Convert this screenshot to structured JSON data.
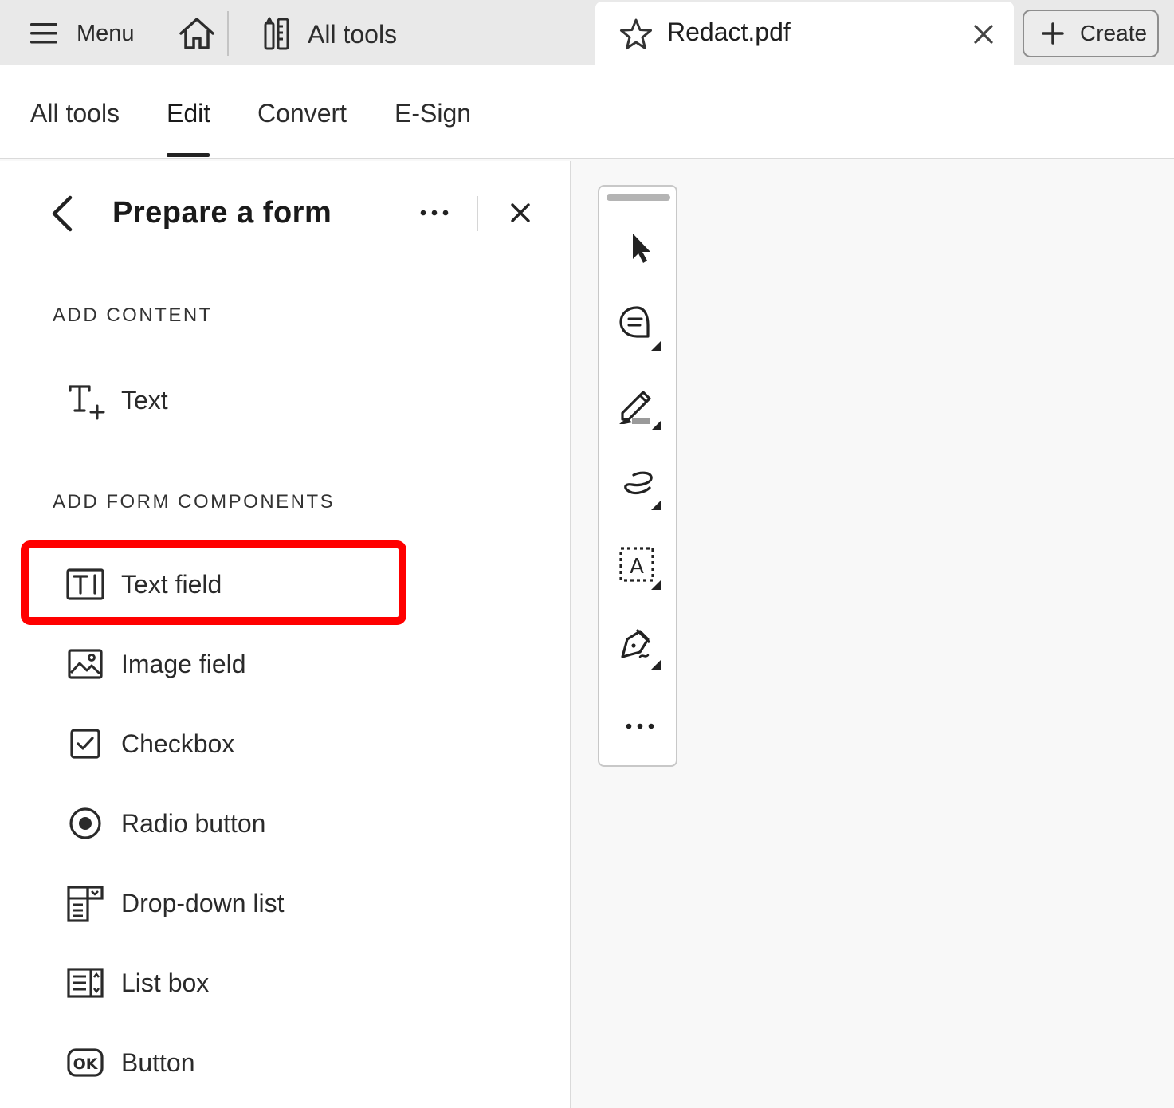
{
  "topbar": {
    "menu_label": "Menu",
    "all_tools_label": "All tools",
    "tab_title": "Redact.pdf",
    "create_label": "Create"
  },
  "nav": {
    "tabs": [
      {
        "label": "All tools"
      },
      {
        "label": "Edit"
      },
      {
        "label": "Convert"
      },
      {
        "label": "E-Sign"
      }
    ],
    "active": "Edit"
  },
  "panel": {
    "title": "Prepare a form",
    "section_add_content": "ADD CONTENT",
    "content_items": [
      {
        "label": "Text",
        "icon": "text-add-icon"
      }
    ],
    "section_form_components": "ADD FORM COMPONENTS",
    "form_items": [
      {
        "label": "Text field",
        "icon": "text-field-icon"
      },
      {
        "label": "Image field",
        "icon": "image-field-icon"
      },
      {
        "label": "Checkbox",
        "icon": "checkbox-icon"
      },
      {
        "label": "Radio button",
        "icon": "radio-button-icon"
      },
      {
        "label": "Drop-down list",
        "icon": "dropdown-list-icon"
      },
      {
        "label": "List box",
        "icon": "list-box-icon"
      },
      {
        "label": "Button",
        "icon": "ok-button-icon"
      }
    ],
    "highlighted_item": "Text field"
  },
  "quick_tools": [
    {
      "icon": "select-cursor-icon"
    },
    {
      "icon": "comment-icon"
    },
    {
      "icon": "highlight-pen-icon"
    },
    {
      "icon": "freehand-draw-icon"
    },
    {
      "icon": "text-box-icon"
    },
    {
      "icon": "sign-pen-icon"
    },
    {
      "icon": "more-icon"
    }
  ],
  "colors": {
    "highlight": "#ff0000",
    "topbar_bg": "#e9e9e9"
  }
}
